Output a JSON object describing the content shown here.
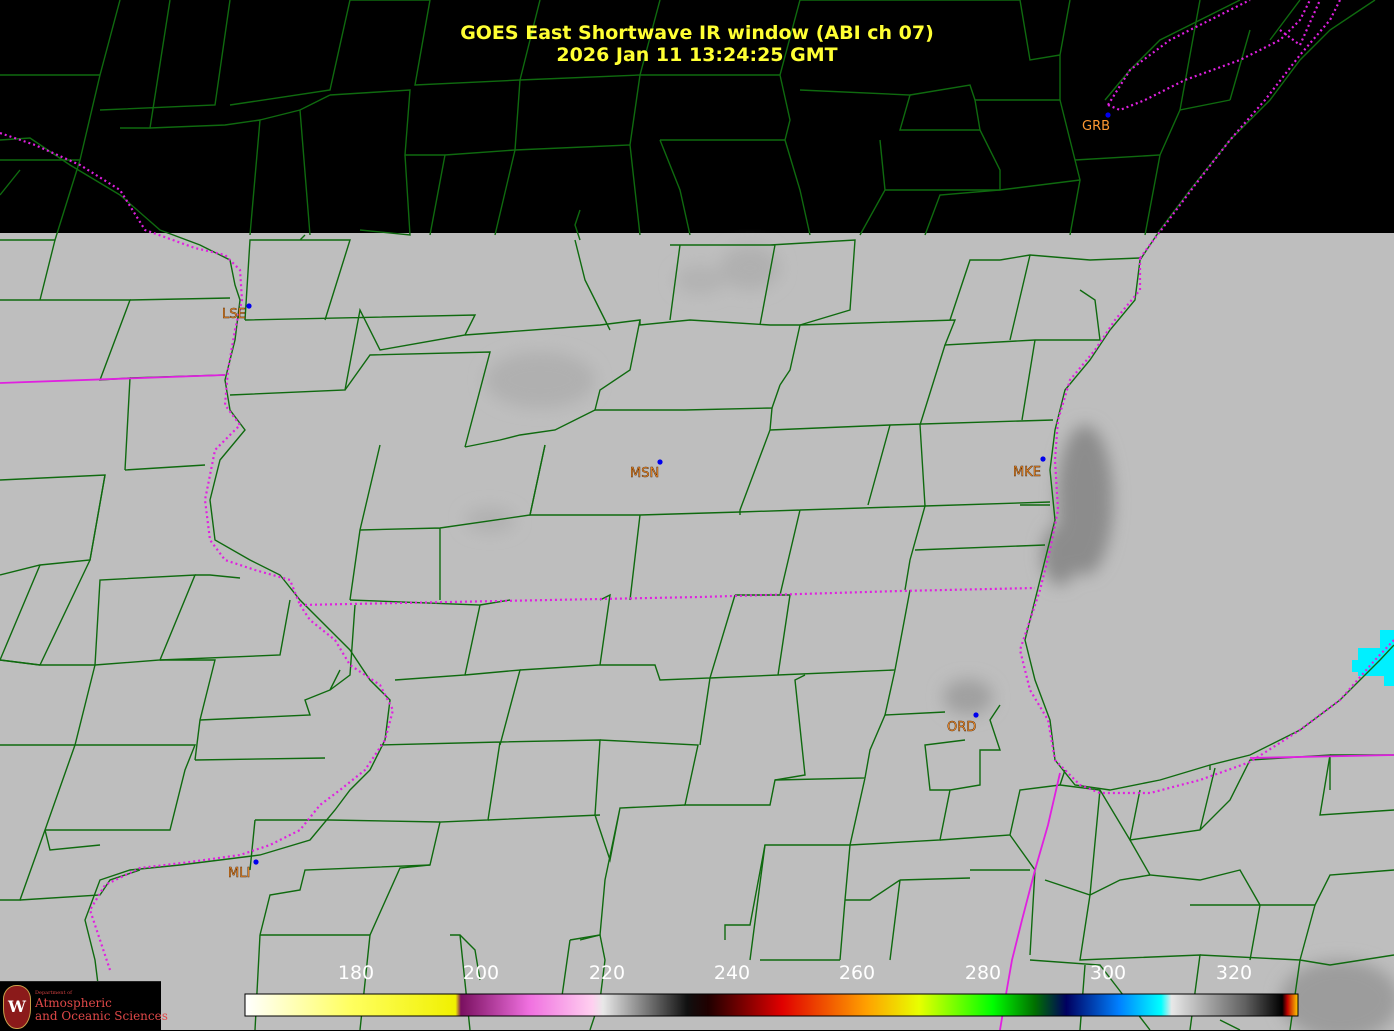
{
  "title": {
    "line1": "GOES East Shortwave IR window (ABI ch 07)",
    "line2": "2026 Jan 11  13:24:25 GMT"
  },
  "stations": [
    {
      "id": "GRB"
    },
    {
      "id": "LSE"
    },
    {
      "id": "MSN"
    },
    {
      "id": "MKE"
    },
    {
      "id": "ORD"
    },
    {
      "id": "MLI"
    }
  ],
  "colorbar": {
    "ticks": [
      "180",
      "200",
      "220",
      "240",
      "260",
      "280",
      "300",
      "320"
    ],
    "range": [
      163,
      330
    ]
  },
  "logo": {
    "dept": "Department of",
    "line1": "Atmospheric",
    "line2": "and Oceanic Sciences",
    "mark": "W"
  },
  "colors": {
    "background": "#000000",
    "cloud_gray": "#bebebe",
    "title": "#ffff33",
    "county_lines": "#0f6a0f",
    "state_lines": "#e020e0",
    "station_label": "#ff9933",
    "station_dot": "#0000ee"
  }
}
